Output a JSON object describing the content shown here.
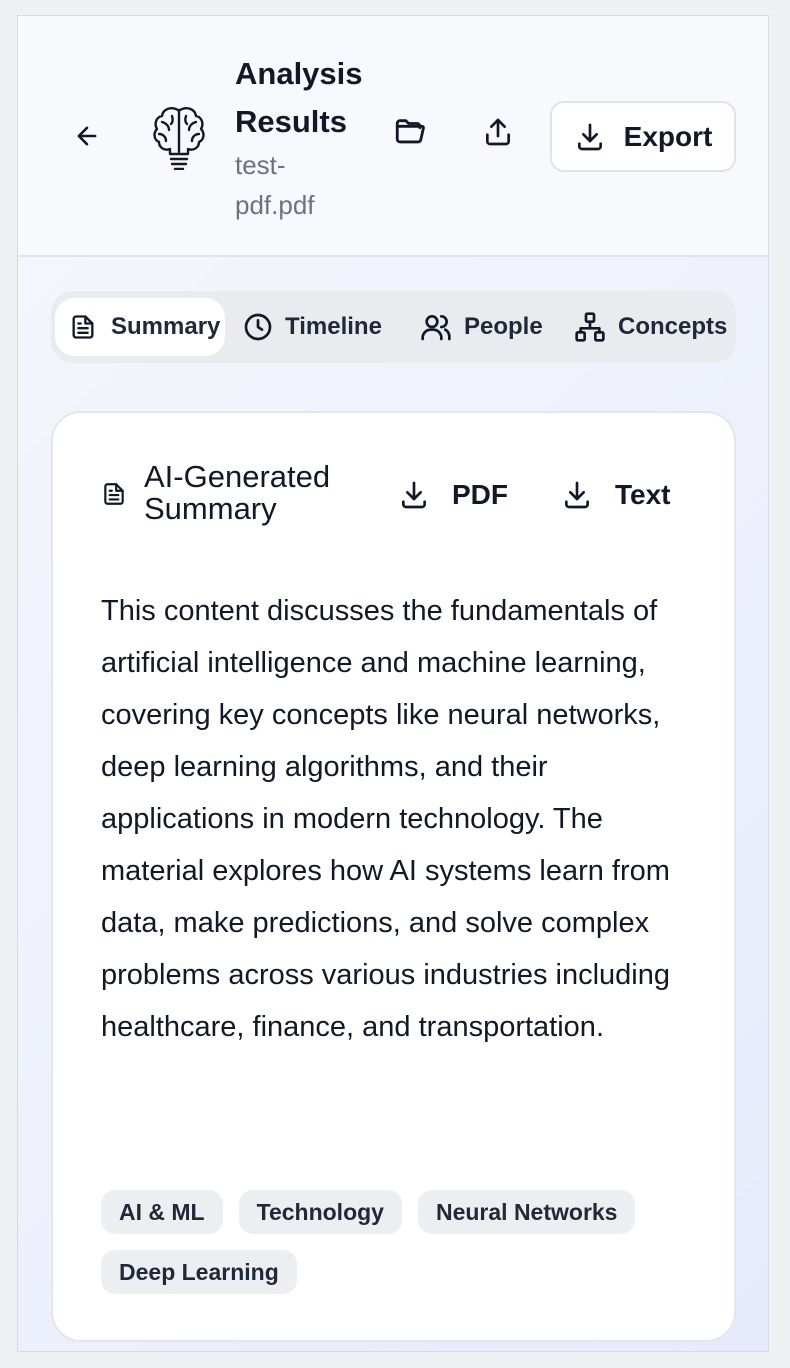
{
  "header": {
    "title": "Analysis Results",
    "filename": "test-pdf.pdf",
    "export_label": "Export"
  },
  "tabs": [
    {
      "label": "Summary",
      "icon": "document-icon",
      "active": true
    },
    {
      "label": "Timeline",
      "icon": "clock-icon",
      "active": false
    },
    {
      "label": "People",
      "icon": "users-icon",
      "active": false
    },
    {
      "label": "Concepts",
      "icon": "hierarchy-icon",
      "active": false
    }
  ],
  "summary_card": {
    "title": "AI-Generated Summary",
    "pdf_label": "PDF",
    "text_label": "Text",
    "body": "This content discusses the fundamentals of artificial intelligence and machine learning, covering key concepts like neural networks, deep learning algorithms, and their applications in modern technology. The material explores how AI systems learn from data, make predictions, and solve complex problems across various industries including healthcare, finance, and transportation.",
    "tags": [
      "AI & ML",
      "Technology",
      "Neural Networks",
      "Deep Learning"
    ]
  },
  "colors": {
    "accent_text": "#111827",
    "muted_text": "#6b7280",
    "tag_bg": "#eceef2"
  }
}
